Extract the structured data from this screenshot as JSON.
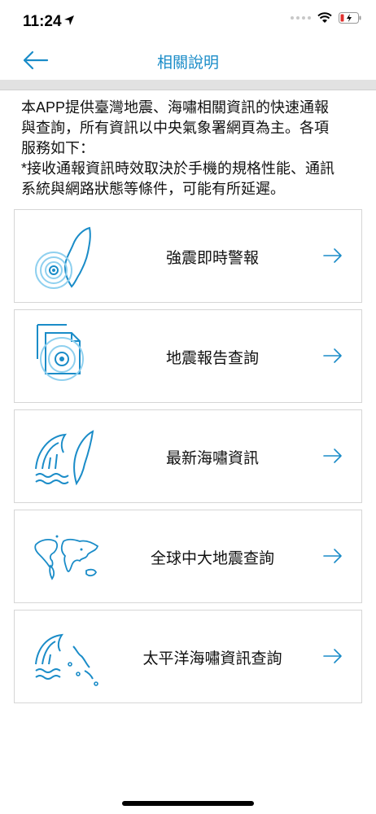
{
  "status_bar": {
    "time": "11:24"
  },
  "nav": {
    "title": "相關說明"
  },
  "intro": {
    "lines": [
      "本APP提供臺灣地震、海嘯相關資訊的快速通報",
      "與查詢，所有資訊以中央氣象署網頁為主。各項",
      "服務如下：",
      "*接收通報資訊時效取決於手機的規格性能、通訊",
      "系統與網路狀態等條件，可能有所延遲。"
    ]
  },
  "menu": {
    "items": [
      {
        "label": "強震即時警報",
        "icon": "taiwan-quake-icon"
      },
      {
        "label": "地震報告查詢",
        "icon": "quake-report-icon"
      },
      {
        "label": "最新海嘯資訊",
        "icon": "tsunami-taiwan-icon"
      },
      {
        "label": "全球中大地震查詢",
        "icon": "world-map-icon"
      },
      {
        "label": "太平洋海嘯資訊查詢",
        "icon": "pacific-tsunami-icon"
      }
    ]
  },
  "colors": {
    "accent": "#1a8cc8",
    "icon_light": "#8fd0ef",
    "divider": "#e2e2e2"
  }
}
